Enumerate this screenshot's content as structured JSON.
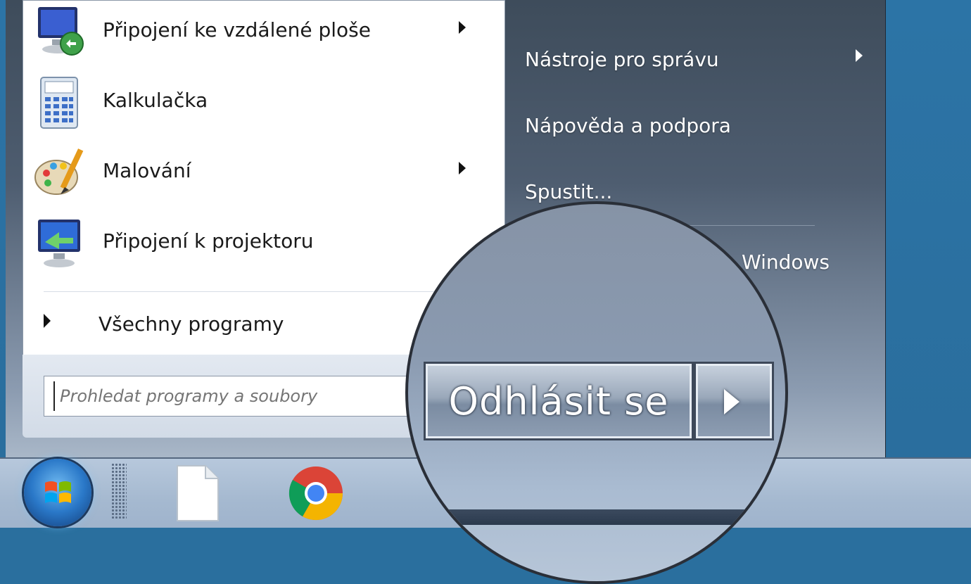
{
  "left_pane": {
    "programs": [
      {
        "label": "Připojení ke vzdálené ploše",
        "icon": "remote-desktop-icon",
        "has_submenu": true
      },
      {
        "label": "Kalkulačka",
        "icon": "calculator-icon",
        "has_submenu": false
      },
      {
        "label": "Malování",
        "icon": "paint-icon",
        "has_submenu": true
      },
      {
        "label": "Připojení k projektoru",
        "icon": "projector-icon",
        "has_submenu": false
      }
    ],
    "all_programs": "Všechny programy",
    "search_placeholder": "Prohledat programy a soubory"
  },
  "right_pane": {
    "items": [
      {
        "label": "Nástroje pro správu",
        "has_submenu": true
      },
      {
        "label": "Nápověda a podpora",
        "has_submenu": false
      },
      {
        "label": "Spustit...",
        "has_submenu": false
      }
    ],
    "partial_item": "Windows"
  },
  "magnifier": {
    "logoff_label": "Odhlásit se"
  },
  "taskbar": {
    "icons": [
      "start-orb-icon",
      "file-icon",
      "chrome-icon"
    ]
  }
}
